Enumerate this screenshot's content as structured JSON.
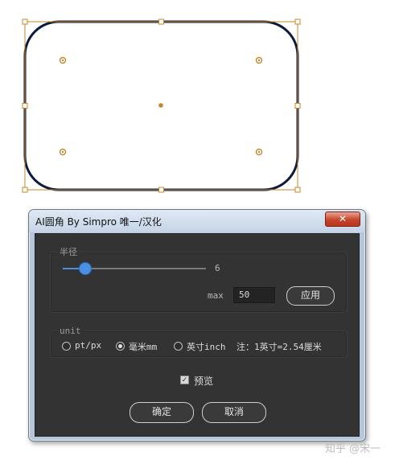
{
  "dialog": {
    "title": "AI圆角 By Simpro 唯一/汉化",
    "close_glyph": "✕"
  },
  "radius_group": {
    "label": "半径",
    "slider_value": "6",
    "slider_fraction": 0.15,
    "max_label": "max",
    "max_value": "50",
    "apply_label": "应用"
  },
  "unit_group": {
    "label": "unit",
    "options": [
      {
        "label": "pt/px",
        "selected": false
      },
      {
        "label": "毫米mm",
        "selected": true
      },
      {
        "label": "英寸inch",
        "selected": false
      }
    ],
    "note": "注：1英寸=2.54厘米"
  },
  "preview": {
    "label": "预览",
    "checked": true
  },
  "buttons": {
    "ok": "确定",
    "cancel": "取消"
  },
  "watermark": "知乎 @宋一",
  "colors": {
    "accent": "#4a90e2",
    "panel_bg": "#333333",
    "rect_stroke": "#0d1b3e",
    "bbox_stroke": "#c8862a"
  }
}
